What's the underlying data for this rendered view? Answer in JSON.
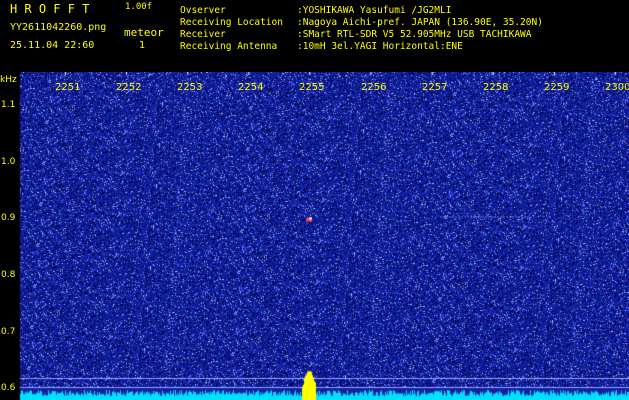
{
  "header": {
    "app_title": "HROFFT",
    "version": "1.00f",
    "filename": "YY2611042260.png",
    "datetime": "25.11.04 22:60",
    "count_label": "meteor",
    "count_value": "1"
  },
  "station": [
    {
      "label": "Ovserver",
      "value": ":YOSHIKAWA Yasufumi /JG2MLI"
    },
    {
      "label": "Receiving Location",
      "value": ":Nagoya Aichi-pref. JAPAN (136.90E, 35.20N)"
    },
    {
      "label": "Receiver",
      "value": ":SMart RTL-SDR V5 52.905MHz USB TACHIKAWA"
    },
    {
      "label": "Receiving Antenna",
      "value": ":10mH 3el.YAGI Horizontal:ENE"
    }
  ],
  "colors": {
    "text": "#ffff00",
    "background_blue": "#1020a0",
    "noise_floor": "#00e0ff",
    "echo_bar": "#ffff00",
    "echo_spot": "#ff4040",
    "guide_line": "#9aa0ff"
  },
  "chart_data": {
    "type": "heatmap",
    "ylabel": "kHz",
    "x_ticks": [
      "2251",
      "2252",
      "2253",
      "2254",
      "2255",
      "2256",
      "2257",
      "2258",
      "2259",
      "2300"
    ],
    "y_ticks": [
      "1.1",
      "1.0",
      "0.9",
      "0.8",
      "0.7",
      "0.6"
    ],
    "ylim": [
      0.585,
      1.16
    ],
    "xlim": [
      2250.6,
      2300.25
    ],
    "guide_lines_khz": [
      0.62,
      0.605
    ],
    "events": [
      {
        "label": "meteor",
        "time": "2255.2",
        "khz": 0.9
      }
    ]
  }
}
